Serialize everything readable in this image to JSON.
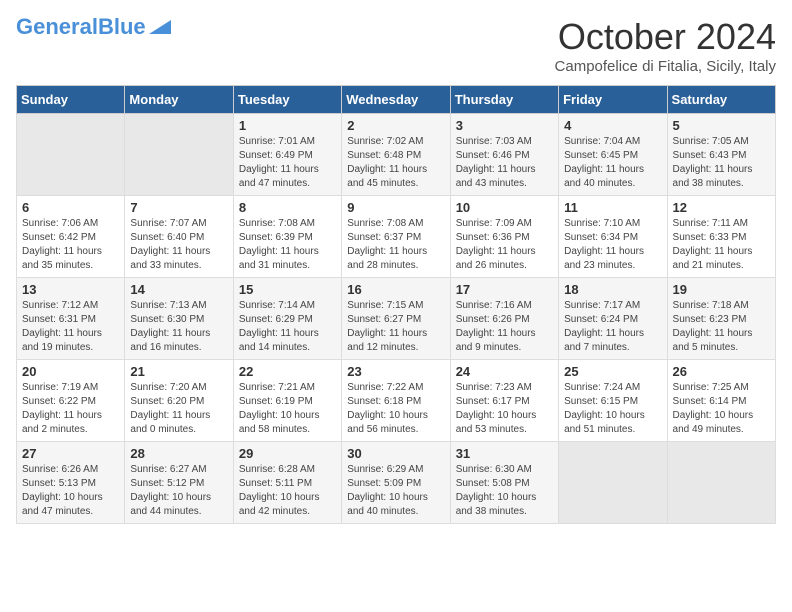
{
  "header": {
    "logo_line1": "General",
    "logo_line2": "Blue",
    "month": "October 2024",
    "location": "Campofelice di Fitalia, Sicily, Italy"
  },
  "days_of_week": [
    "Sunday",
    "Monday",
    "Tuesday",
    "Wednesday",
    "Thursday",
    "Friday",
    "Saturday"
  ],
  "weeks": [
    [
      {
        "day": "",
        "empty": true
      },
      {
        "day": "",
        "empty": true
      },
      {
        "day": "1",
        "sunrise": "Sunrise: 7:01 AM",
        "sunset": "Sunset: 6:49 PM",
        "daylight": "Daylight: 11 hours and 47 minutes."
      },
      {
        "day": "2",
        "sunrise": "Sunrise: 7:02 AM",
        "sunset": "Sunset: 6:48 PM",
        "daylight": "Daylight: 11 hours and 45 minutes."
      },
      {
        "day": "3",
        "sunrise": "Sunrise: 7:03 AM",
        "sunset": "Sunset: 6:46 PM",
        "daylight": "Daylight: 11 hours and 43 minutes."
      },
      {
        "day": "4",
        "sunrise": "Sunrise: 7:04 AM",
        "sunset": "Sunset: 6:45 PM",
        "daylight": "Daylight: 11 hours and 40 minutes."
      },
      {
        "day": "5",
        "sunrise": "Sunrise: 7:05 AM",
        "sunset": "Sunset: 6:43 PM",
        "daylight": "Daylight: 11 hours and 38 minutes."
      }
    ],
    [
      {
        "day": "6",
        "sunrise": "Sunrise: 7:06 AM",
        "sunset": "Sunset: 6:42 PM",
        "daylight": "Daylight: 11 hours and 35 minutes."
      },
      {
        "day": "7",
        "sunrise": "Sunrise: 7:07 AM",
        "sunset": "Sunset: 6:40 PM",
        "daylight": "Daylight: 11 hours and 33 minutes."
      },
      {
        "day": "8",
        "sunrise": "Sunrise: 7:08 AM",
        "sunset": "Sunset: 6:39 PM",
        "daylight": "Daylight: 11 hours and 31 minutes."
      },
      {
        "day": "9",
        "sunrise": "Sunrise: 7:08 AM",
        "sunset": "Sunset: 6:37 PM",
        "daylight": "Daylight: 11 hours and 28 minutes."
      },
      {
        "day": "10",
        "sunrise": "Sunrise: 7:09 AM",
        "sunset": "Sunset: 6:36 PM",
        "daylight": "Daylight: 11 hours and 26 minutes."
      },
      {
        "day": "11",
        "sunrise": "Sunrise: 7:10 AM",
        "sunset": "Sunset: 6:34 PM",
        "daylight": "Daylight: 11 hours and 23 minutes."
      },
      {
        "day": "12",
        "sunrise": "Sunrise: 7:11 AM",
        "sunset": "Sunset: 6:33 PM",
        "daylight": "Daylight: 11 hours and 21 minutes."
      }
    ],
    [
      {
        "day": "13",
        "sunrise": "Sunrise: 7:12 AM",
        "sunset": "Sunset: 6:31 PM",
        "daylight": "Daylight: 11 hours and 19 minutes."
      },
      {
        "day": "14",
        "sunrise": "Sunrise: 7:13 AM",
        "sunset": "Sunset: 6:30 PM",
        "daylight": "Daylight: 11 hours and 16 minutes."
      },
      {
        "day": "15",
        "sunrise": "Sunrise: 7:14 AM",
        "sunset": "Sunset: 6:29 PM",
        "daylight": "Daylight: 11 hours and 14 minutes."
      },
      {
        "day": "16",
        "sunrise": "Sunrise: 7:15 AM",
        "sunset": "Sunset: 6:27 PM",
        "daylight": "Daylight: 11 hours and 12 minutes."
      },
      {
        "day": "17",
        "sunrise": "Sunrise: 7:16 AM",
        "sunset": "Sunset: 6:26 PM",
        "daylight": "Daylight: 11 hours and 9 minutes."
      },
      {
        "day": "18",
        "sunrise": "Sunrise: 7:17 AM",
        "sunset": "Sunset: 6:24 PM",
        "daylight": "Daylight: 11 hours and 7 minutes."
      },
      {
        "day": "19",
        "sunrise": "Sunrise: 7:18 AM",
        "sunset": "Sunset: 6:23 PM",
        "daylight": "Daylight: 11 hours and 5 minutes."
      }
    ],
    [
      {
        "day": "20",
        "sunrise": "Sunrise: 7:19 AM",
        "sunset": "Sunset: 6:22 PM",
        "daylight": "Daylight: 11 hours and 2 minutes."
      },
      {
        "day": "21",
        "sunrise": "Sunrise: 7:20 AM",
        "sunset": "Sunset: 6:20 PM",
        "daylight": "Daylight: 11 hours and 0 minutes."
      },
      {
        "day": "22",
        "sunrise": "Sunrise: 7:21 AM",
        "sunset": "Sunset: 6:19 PM",
        "daylight": "Daylight: 10 hours and 58 minutes."
      },
      {
        "day": "23",
        "sunrise": "Sunrise: 7:22 AM",
        "sunset": "Sunset: 6:18 PM",
        "daylight": "Daylight: 10 hours and 56 minutes."
      },
      {
        "day": "24",
        "sunrise": "Sunrise: 7:23 AM",
        "sunset": "Sunset: 6:17 PM",
        "daylight": "Daylight: 10 hours and 53 minutes."
      },
      {
        "day": "25",
        "sunrise": "Sunrise: 7:24 AM",
        "sunset": "Sunset: 6:15 PM",
        "daylight": "Daylight: 10 hours and 51 minutes."
      },
      {
        "day": "26",
        "sunrise": "Sunrise: 7:25 AM",
        "sunset": "Sunset: 6:14 PM",
        "daylight": "Daylight: 10 hours and 49 minutes."
      }
    ],
    [
      {
        "day": "27",
        "sunrise": "Sunrise: 6:26 AM",
        "sunset": "Sunset: 5:13 PM",
        "daylight": "Daylight: 10 hours and 47 minutes."
      },
      {
        "day": "28",
        "sunrise": "Sunrise: 6:27 AM",
        "sunset": "Sunset: 5:12 PM",
        "daylight": "Daylight: 10 hours and 44 minutes."
      },
      {
        "day": "29",
        "sunrise": "Sunrise: 6:28 AM",
        "sunset": "Sunset: 5:11 PM",
        "daylight": "Daylight: 10 hours and 42 minutes."
      },
      {
        "day": "30",
        "sunrise": "Sunrise: 6:29 AM",
        "sunset": "Sunset: 5:09 PM",
        "daylight": "Daylight: 10 hours and 40 minutes."
      },
      {
        "day": "31",
        "sunrise": "Sunrise: 6:30 AM",
        "sunset": "Sunset: 5:08 PM",
        "daylight": "Daylight: 10 hours and 38 minutes."
      },
      {
        "day": "",
        "empty": true
      },
      {
        "day": "",
        "empty": true
      }
    ]
  ]
}
